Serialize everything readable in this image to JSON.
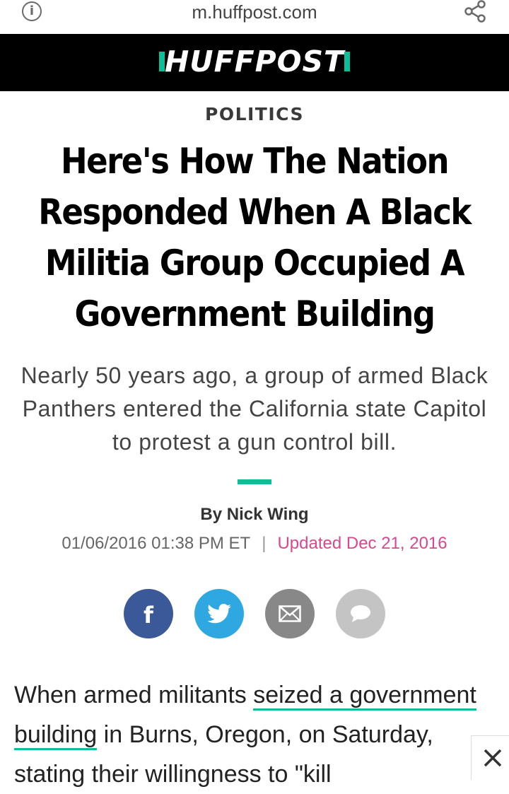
{
  "browser": {
    "url": "m.huffpost.com",
    "info_icon": "info-icon",
    "share_icon": "share-icon"
  },
  "masthead": {
    "logo_text": "HUFFPOST",
    "accent_color": "#0dbe98"
  },
  "article": {
    "section": "POLITICS",
    "headline": "Here's How The Nation Responded When A Black Militia Group Occupied A Government Building",
    "dek": "Nearly 50 years ago, a group of armed Black Panthers entered the California state Capitol to protest a gun control bill.",
    "byline": "By Nick Wing",
    "published": "01/06/2016 01:38 PM ET",
    "separator": "|",
    "updated": "Updated Dec 21, 2016",
    "updated_color": "#d9488c",
    "body": {
      "p1_before": "When armed militants ",
      "p1_link": "seized a government building",
      "p1_after": " in Burns, Oregon, on Saturday, stating their willingness to \"kill"
    }
  },
  "share_buttons": [
    {
      "name": "facebook-icon",
      "color": "#3b5998"
    },
    {
      "name": "twitter-icon",
      "color": "#2fa8e2"
    },
    {
      "name": "email-icon",
      "color": "#888888"
    },
    {
      "name": "comment-icon",
      "color": "#c4c4c4"
    }
  ],
  "close_icon": "close-icon"
}
